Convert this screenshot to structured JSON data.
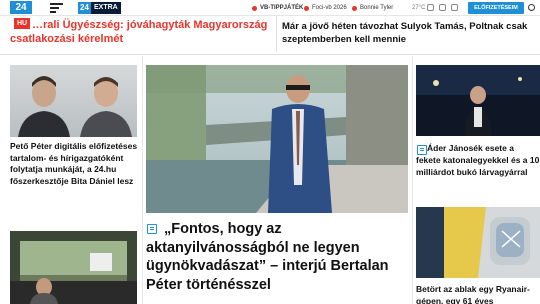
{
  "header": {
    "logo_text": "24",
    "extra_badge_num": "24",
    "extra_badge_text": "EXTRA",
    "nav": [
      {
        "label": "VB-TIPPJÁTÉK"
      },
      {
        "label": "Foci-vb 2026"
      },
      {
        "label": "Bonnie Tyler"
      }
    ],
    "weather": "27°C",
    "subscribe_label": "ELŐFIZETÉSEIM"
  },
  "top_headlines": {
    "left_tag": "HU",
    "left": "…rali Ügyészség: jóváhagyták Magyarország csatlakozási kérelmét",
    "right": "Már a jövő héten távozhat Sulyok Tamás, Poltnak csak szeptemberben kell mennie"
  },
  "left_column": {
    "headline": "Pető Péter digitális előfizetéses tartalom- és hírigazgatóként folytatja munkáját, a 24.hu főszerkesztője Bita Dániel lesz"
  },
  "center_column": {
    "headline": "„Fontos, hogy az aktanyilvánosságból ne legyen ügynökvadászat” – interjú Bertalan Péter történésszel"
  },
  "right_column": {
    "headline1": "Áder Jánosék esete a fekete katonalegyekkel és a 10 milliárdot bukó lárvagyárral",
    "headline2": "Betört az ablak egy Ryanair-gépen, egy 61 éves"
  },
  "colors": {
    "accent_blue": "#1f8fd6",
    "accent_red": "#e8352c"
  }
}
